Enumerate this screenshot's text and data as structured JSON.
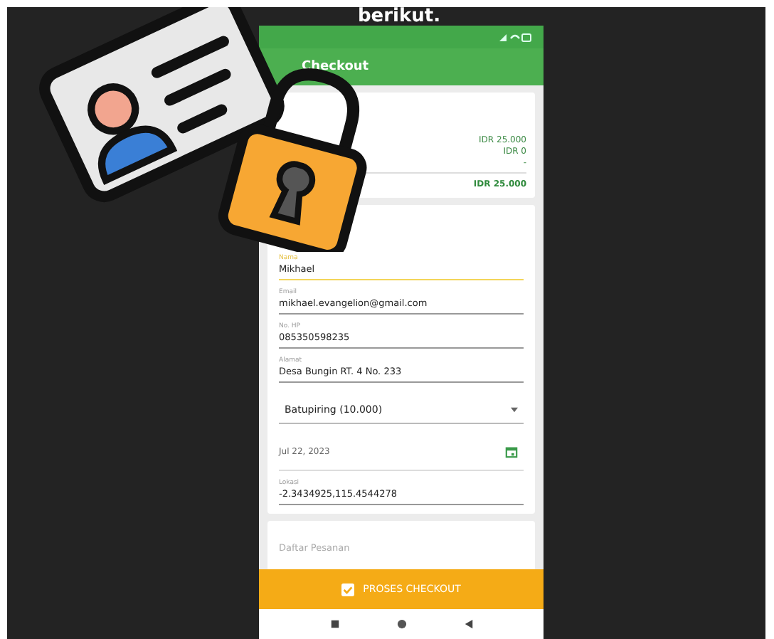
{
  "caption": "berikut.",
  "app_bar": {
    "title": "Checkout"
  },
  "summary": {
    "amounts": [
      "IDR 25.000",
      "IDR 0",
      "-"
    ],
    "total": "IDR 25.000"
  },
  "form": [
    {
      "kind": "text",
      "label": "Nama",
      "value": "Mikhael",
      "focused": true
    },
    {
      "kind": "text",
      "label": "Email",
      "value": "mikhael.evangelion@gmail.com",
      "focused": false
    },
    {
      "kind": "text",
      "label": "No. HP",
      "value": "085350598235",
      "focused": false
    },
    {
      "kind": "text",
      "label": "Alamat",
      "value": "Desa Bungin RT. 4 No. 233",
      "focused": false
    },
    {
      "kind": "dropdown",
      "value": "Batupiring (10.000)",
      "focused": false
    },
    {
      "kind": "date",
      "value": "Jul 22, 2023",
      "focused": false
    },
    {
      "kind": "text",
      "label": "Lokasi",
      "value": "-2.3434925,115.4544278",
      "focused": false
    }
  ],
  "orders": {
    "title": "Daftar Pesanan"
  },
  "checkout_button": {
    "label": "PROSES CHECKOUT"
  }
}
